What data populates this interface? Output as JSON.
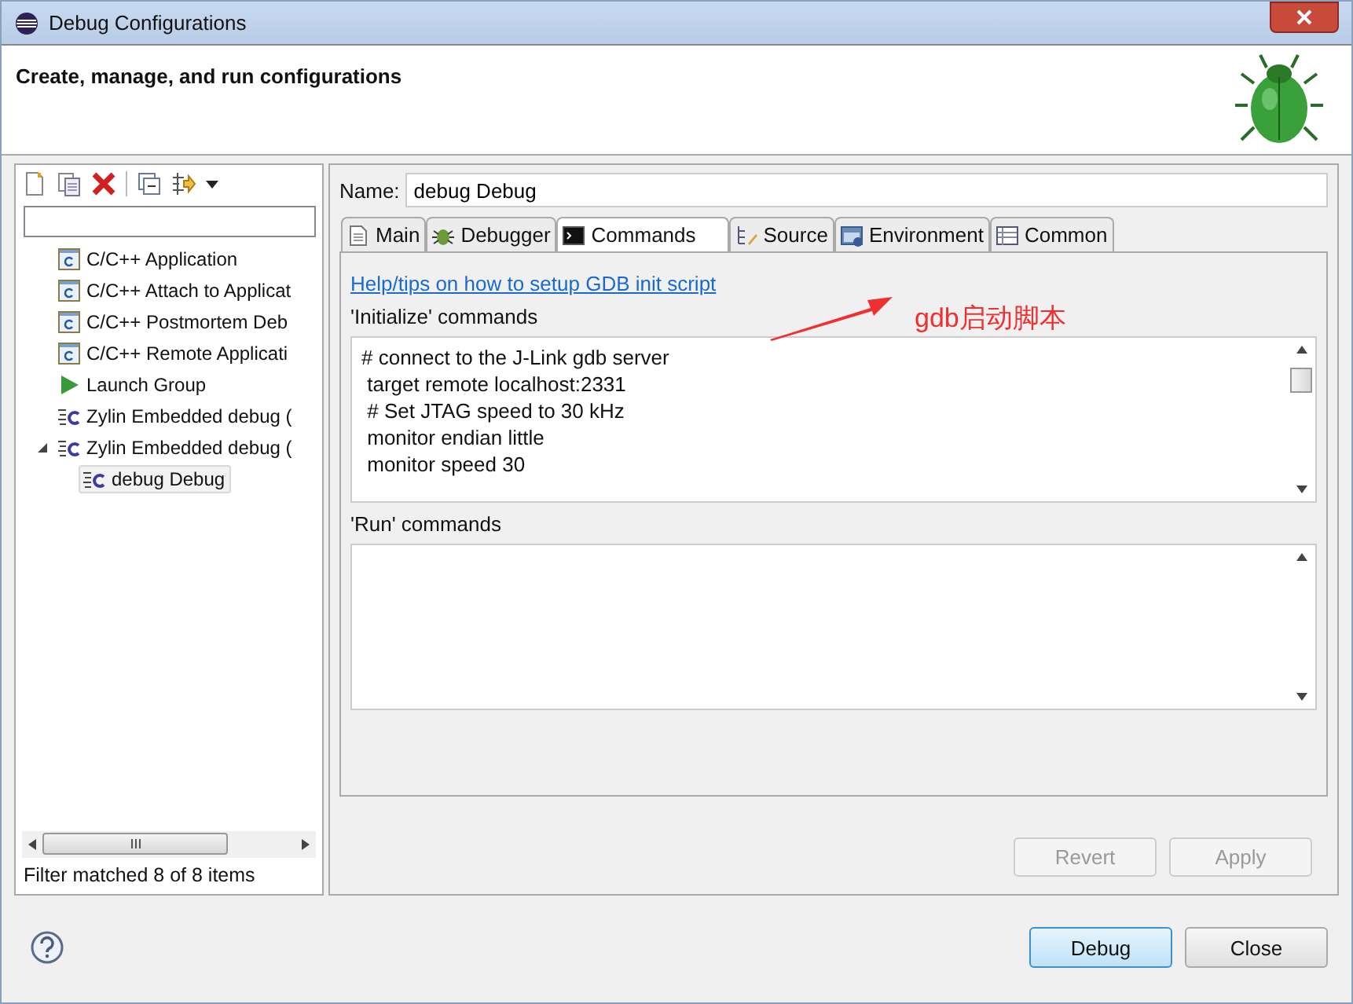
{
  "window": {
    "title": "Debug Configurations"
  },
  "header": {
    "title": "Create, manage, and run configurations"
  },
  "sidebar": {
    "tree": [
      {
        "label": "C/C++ Application",
        "kind": "cpp",
        "selected": false
      },
      {
        "label": "C/C++ Attach to Applicat",
        "kind": "cpp",
        "selected": false
      },
      {
        "label": "C/C++ Postmortem Deb",
        "kind": "cpp",
        "selected": false
      },
      {
        "label": "C/C++ Remote Applicati",
        "kind": "cpp",
        "selected": false
      },
      {
        "label": "Launch Group",
        "kind": "launch",
        "selected": false
      },
      {
        "label": "Zylin Embedded debug (",
        "kind": "zylin",
        "selected": false
      },
      {
        "label": "Zylin Embedded debug (",
        "kind": "zylin",
        "selected": false,
        "expanded": true,
        "children": [
          {
            "label": "debug Debug",
            "kind": "zylin",
            "selected": true
          }
        ]
      }
    ],
    "status": "Filter matched 8 of 8 items"
  },
  "name_field": {
    "label": "Name:",
    "value": "debug Debug"
  },
  "tabs": [
    {
      "label": "Main",
      "kind": "doc",
      "selected": false
    },
    {
      "label": "Debugger",
      "kind": "bug",
      "selected": false
    },
    {
      "label": "Commands",
      "kind": "terminal",
      "selected": true
    },
    {
      "label": "Source",
      "kind": "source",
      "selected": false
    },
    {
      "label": "Environment",
      "kind": "env",
      "selected": false
    },
    {
      "label": "Common",
      "kind": "table",
      "selected": false
    }
  ],
  "help_link": "Help/tips on how to setup GDB init script",
  "init_commands": {
    "label": "'Initialize' commands",
    "lines": [
      "# connect to the J-Link gdb server",
      " target remote localhost:2331",
      " # Set JTAG speed to 30 kHz",
      " monitor endian little",
      " monitor speed 30"
    ]
  },
  "run_commands": {
    "label": "'Run' commands"
  },
  "annotation": {
    "text": "gdb启动脚本"
  },
  "form_buttons": [
    {
      "label": "Revert",
      "disabled": true
    },
    {
      "label": "Apply",
      "disabled": true
    }
  ],
  "dialog_buttons": [
    {
      "label": "Debug",
      "default": true
    },
    {
      "label": "Close",
      "default": false
    }
  ]
}
